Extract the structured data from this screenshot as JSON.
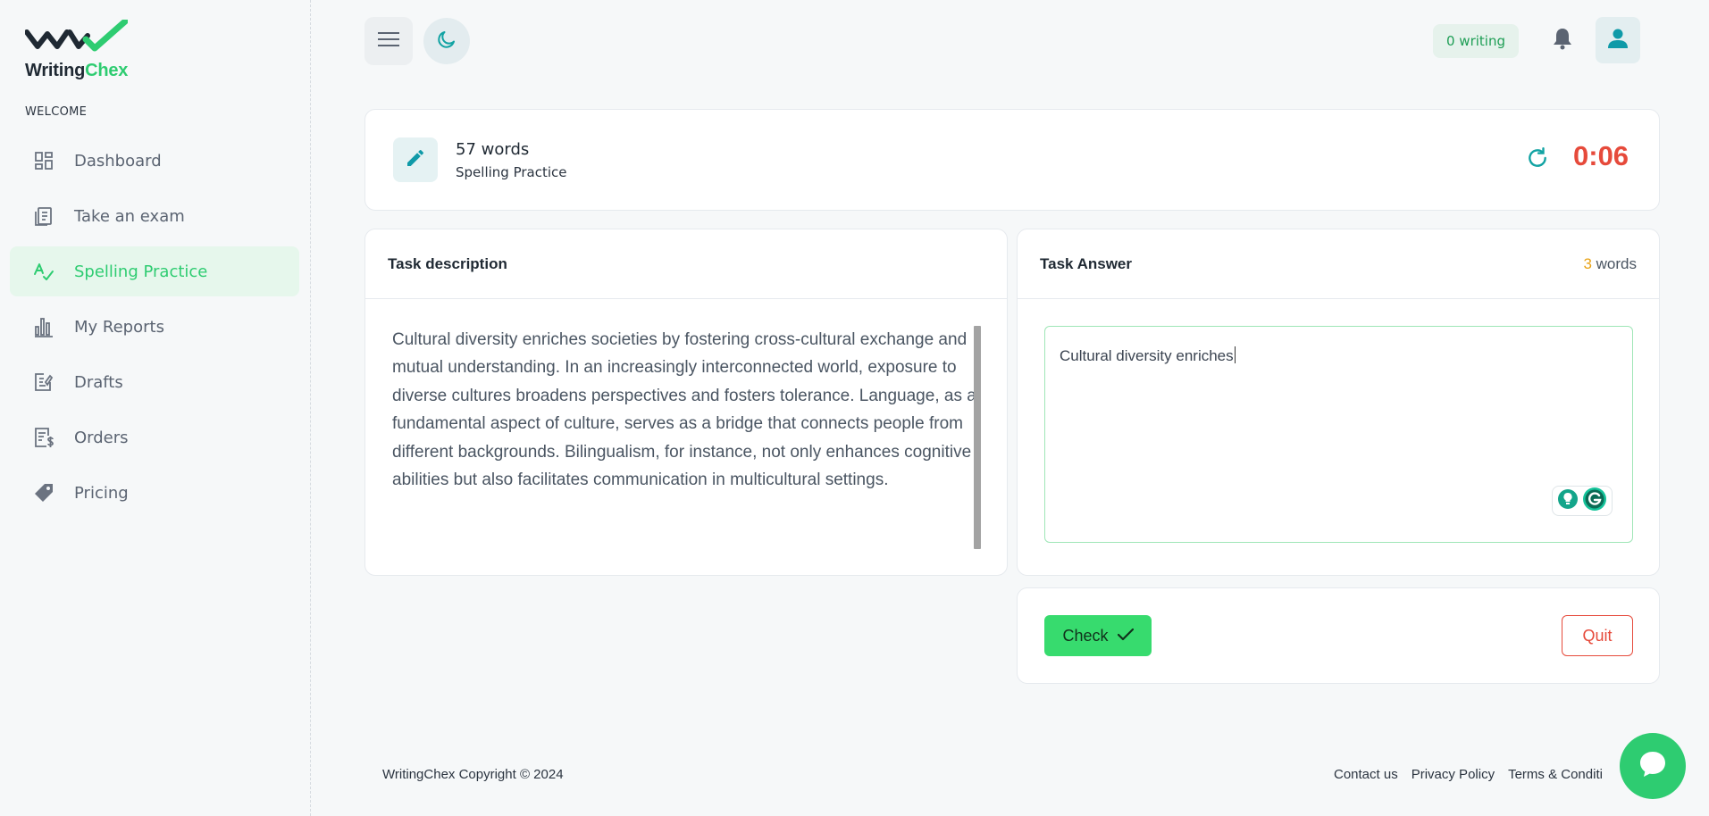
{
  "brand": {
    "name_part1": "Writing",
    "name_part2": "Chex",
    "accent": "#2ecc71"
  },
  "sidebar": {
    "section_label": "WELCOME",
    "items": [
      {
        "label": "Dashboard",
        "icon": "dashboard-icon"
      },
      {
        "label": "Take an exam",
        "icon": "clipboard-icon"
      },
      {
        "label": "Spelling Practice",
        "icon": "spellcheck-icon",
        "active": true
      },
      {
        "label": "My Reports",
        "icon": "bar-chart-icon"
      },
      {
        "label": "Drafts",
        "icon": "edit-note-icon"
      },
      {
        "label": "Orders",
        "icon": "receipt-icon"
      },
      {
        "label": "Pricing",
        "icon": "price-tag-icon"
      }
    ]
  },
  "header": {
    "writing_status": "0 writing",
    "icons": [
      "menu-icon",
      "moon-icon",
      "bell-icon",
      "user-icon"
    ]
  },
  "session": {
    "words_label": "57 words",
    "mode": "Spelling Practice",
    "timer": "0:06",
    "timer_color": "#e64a3b"
  },
  "task_description": {
    "title": "Task description",
    "text": "Cultural diversity enriches societies by fostering cross-cultural exchange and mutual understanding. In an increasingly interconnected world, exposure to diverse cultures broadens perspectives and fosters tolerance. Language, as a fundamental aspect of culture, serves as a bridge that connects people from different backgrounds. Bilingualism, for instance, not only enhances cognitive abilities but also facilitates communication in multicultural settings."
  },
  "task_answer": {
    "title": "Task Answer",
    "word_count": "3",
    "word_count_suffix": " words",
    "value": "Cultural diversity enriches"
  },
  "actions": {
    "check_label": "Check",
    "quit_label": "Quit"
  },
  "footer": {
    "copyright": "WritingChex Copyright © 2024",
    "links": [
      "Contact us",
      "Privacy Policy",
      "Terms & Conditi"
    ]
  }
}
